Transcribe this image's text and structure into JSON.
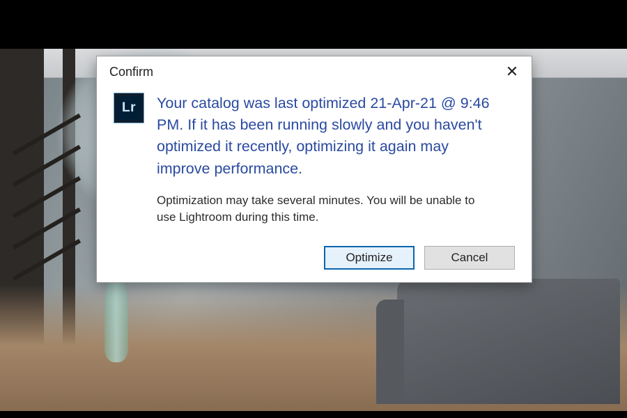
{
  "dialog": {
    "title": "Confirm",
    "close_glyph": "✕",
    "app_icon_text": "Lr",
    "message_main": "Your catalog was last optimized 21-Apr-21 @ 9:46 PM. If it has been running slowly and you haven't optimized it recently, optimizing it again may improve performance.",
    "message_sub": "Optimization may take several minutes. You will be unable to use Lightroom during this time.",
    "buttons": {
      "primary": "Optimize",
      "secondary": "Cancel"
    }
  }
}
